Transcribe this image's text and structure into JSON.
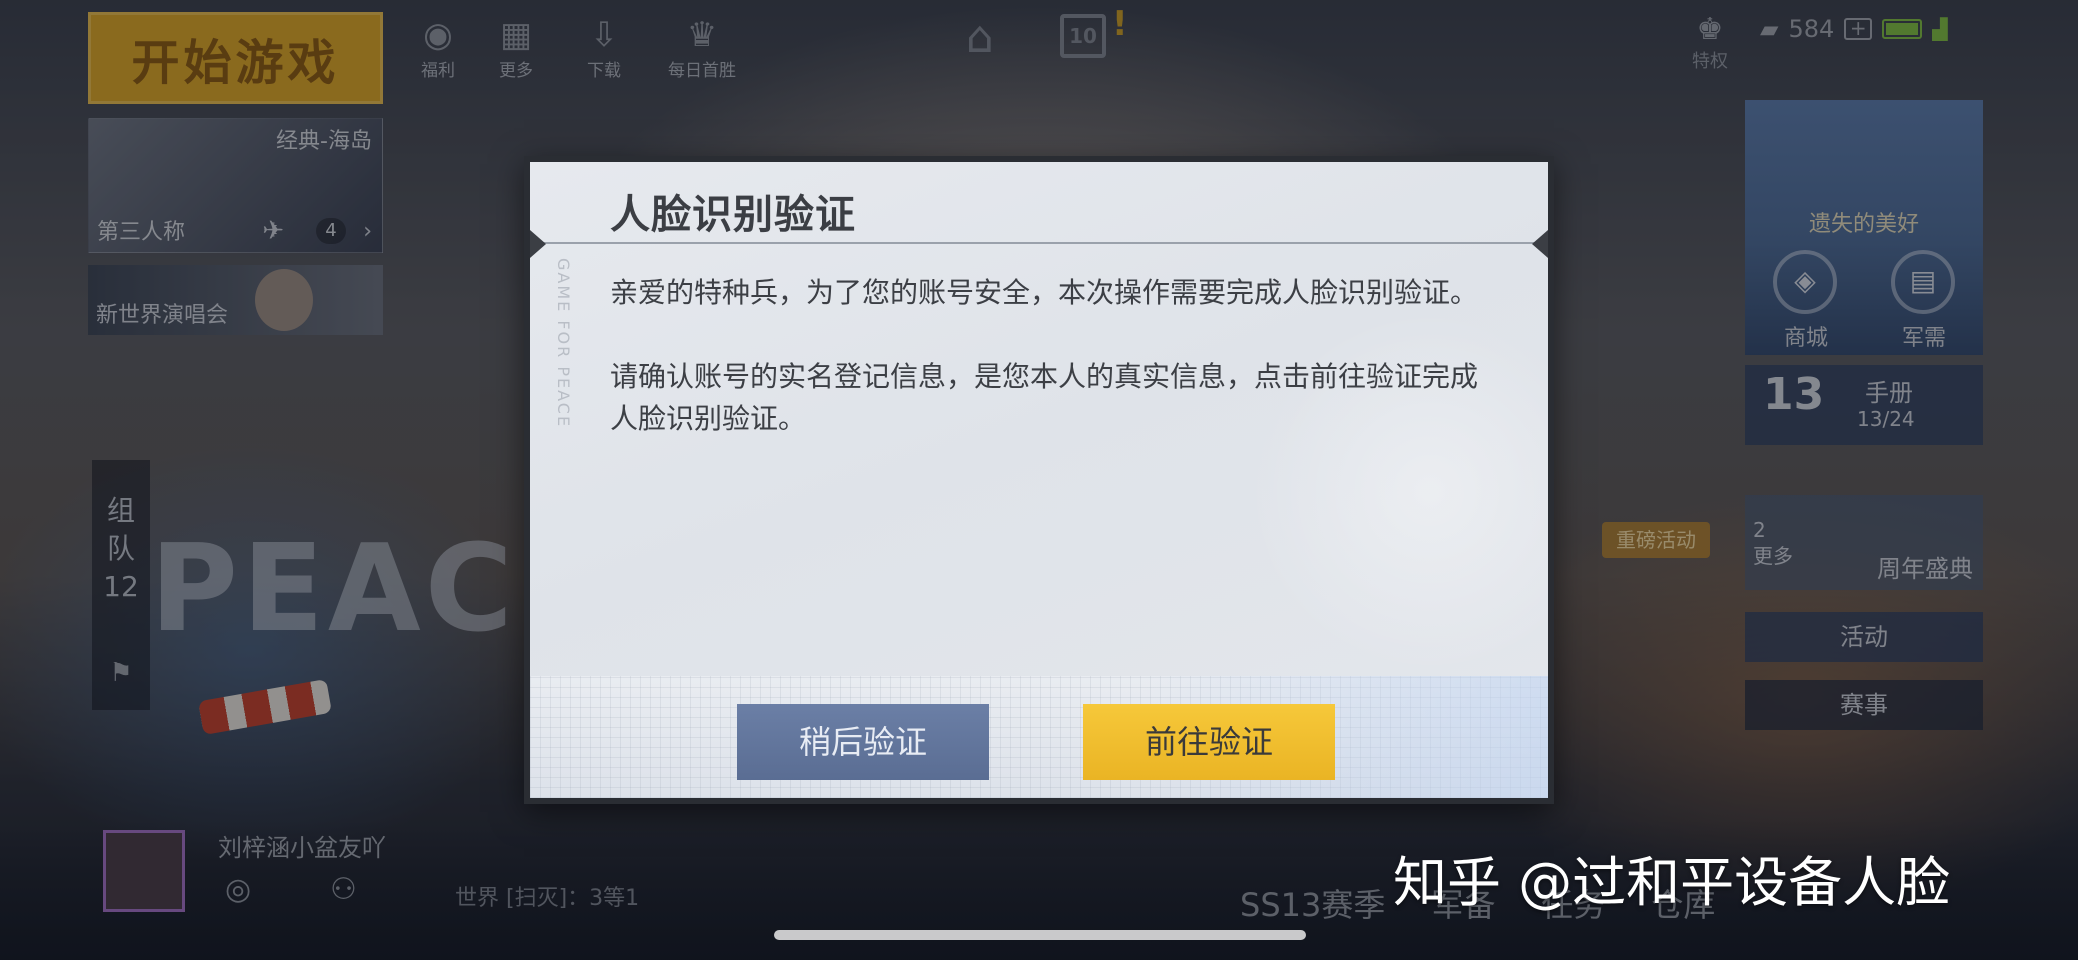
{
  "hud": {
    "start_button": "开始游戏",
    "top_icons": [
      {
        "label": "福利",
        "icon": "penguin-icon"
      },
      {
        "label": "更多",
        "icon": "grid-icon"
      },
      {
        "label": "下载",
        "icon": "download-icon"
      },
      {
        "label": "每日首胜",
        "icon": "trophy-icon"
      }
    ],
    "vip_label": "特权",
    "currency": "584"
  },
  "mode_card": {
    "map": "经典-海岛",
    "perspective": "第三人称",
    "squad_count": "4"
  },
  "concert_label": "新世界演唱会",
  "team": {
    "label_1": "组",
    "label_2": "队",
    "count": "12"
  },
  "right_panel": {
    "promo_title": "遗失的美好",
    "shop_label": "商城",
    "armory_label": "军需",
    "handbook_number": "13",
    "handbook_label": "手册",
    "handbook_progress": "13/24",
    "event_tag": "重磅活动",
    "more_count": "2",
    "more_label": "更多",
    "anniversary_label": "周年盛典",
    "activity_label": "活动",
    "match_label": "赛事"
  },
  "bottom": {
    "player_name": "刘梓涵小盆友吖",
    "chat_preview": "世界 [扫灭]：3等1",
    "menu": [
      "SS13赛季",
      "军备",
      "任务",
      "仓库"
    ]
  },
  "dialog": {
    "title": "人脸识别验证",
    "paragraph_1": "亲爱的特种兵，为了您的账号安全，本次操作需要完成人脸识别验证。",
    "paragraph_2": "请确认账号的实名登记信息，是您本人的真实信息，点击前往验证完成人脸识别验证。",
    "later_button": "稍后验证",
    "go_button": "前往验证"
  },
  "watermark": "知乎 @过和平设备人脸"
}
